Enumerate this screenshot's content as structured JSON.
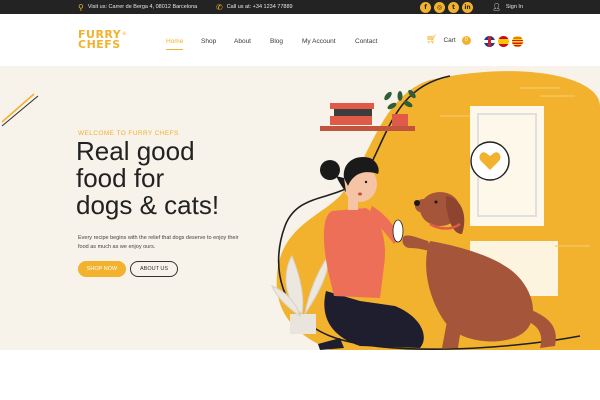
{
  "topbar": {
    "address": "Visit us: Carrer de Berga 4, 08012 Barcelona",
    "phone": "Call us at: +34 1234 77889",
    "socials": [
      {
        "icon": "facebook-icon",
        "glyph": "f"
      },
      {
        "icon": "instagram-icon",
        "glyph": "◎"
      },
      {
        "icon": "twitter-icon",
        "glyph": "t"
      },
      {
        "icon": "linkedin-icon",
        "glyph": "in"
      }
    ],
    "signin": "Sign In"
  },
  "header": {
    "logo_line1": "FURRY",
    "logo_line2": "CHEFS",
    "logo_mark": "®",
    "nav": [
      "Home",
      "Shop",
      "About",
      "Blog",
      "My Account",
      "Contact"
    ],
    "active_nav": "Home",
    "cart_label": "Cart",
    "cart_count": "0",
    "languages": [
      "English",
      "Español",
      "Català"
    ]
  },
  "hero": {
    "eyebrow": "WELCOME TO FURRY CHEFS",
    "headline": [
      "Real good",
      "food for",
      "dogs & cats!"
    ],
    "description": "Every recipe begins with the relief that dogs deserve to enjoy their food as much as we enjoy ours.",
    "primary_button": "SHOP NOW",
    "secondary_button": "ABOUT US"
  },
  "colors": {
    "accent": "#f2b22d",
    "topbar_bg": "#232323",
    "hero_bg": "#f7f2ea",
    "illustration_shirt": "#ee6f57",
    "dog": "#a5563a"
  }
}
